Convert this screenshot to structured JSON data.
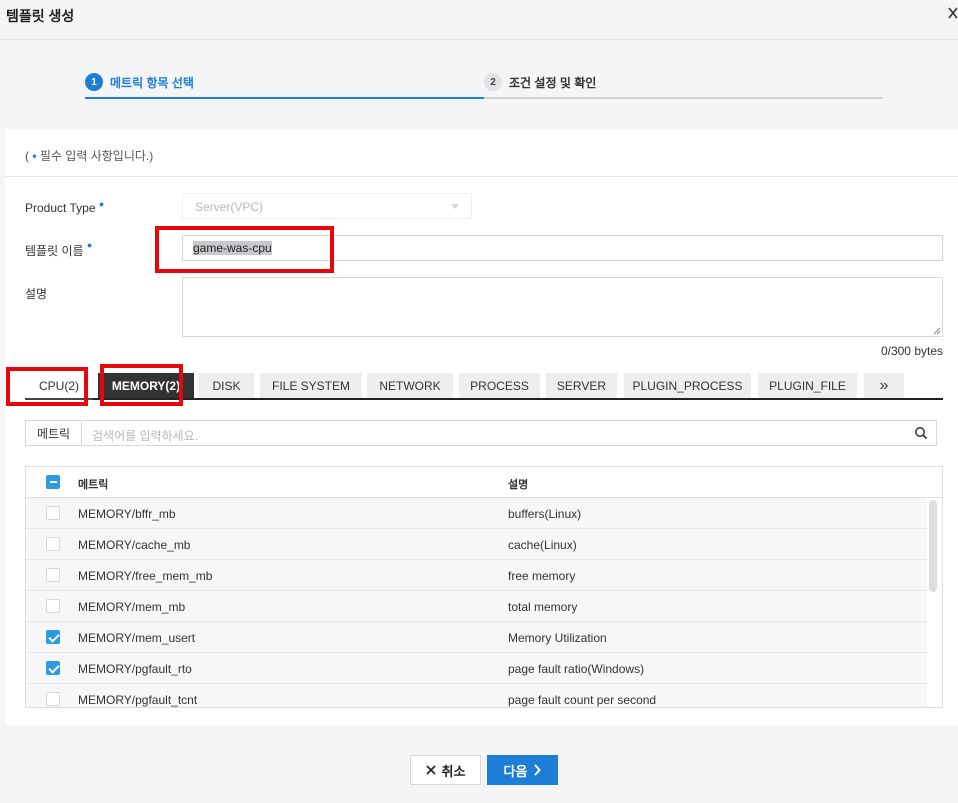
{
  "header": {
    "title": "템플릿 생성",
    "close_icon": "close-icon"
  },
  "steps": [
    {
      "num": "1",
      "label": "메트릭 항목 선택",
      "state": "active"
    },
    {
      "num": "2",
      "label": "조건 설정 및 확인",
      "state": "inactive"
    }
  ],
  "form": {
    "required_note_open": "( ",
    "required_note_dot": "•",
    "required_note_text": " 필수 입력 사항입니다.)",
    "required_dot": "●",
    "product_type_label": "Product Type",
    "product_type_value": "Server(VPC)",
    "template_name_label": "템플릿 이름",
    "template_name_value": "game-was-cpu",
    "description_label": "설명",
    "description_value": "",
    "byte_count": "0/300 bytes"
  },
  "tabs": [
    {
      "label": "CPU(2)",
      "state": "selected-plain"
    },
    {
      "label": "MEMORY(2)",
      "state": "active"
    },
    {
      "label": "DISK"
    },
    {
      "label": "FILE SYSTEM"
    },
    {
      "label": "NETWORK"
    },
    {
      "label": "PROCESS"
    },
    {
      "label": "SERVER"
    },
    {
      "label": "PLUGIN_PROCESS"
    },
    {
      "label": "PLUGIN_FILE"
    },
    {
      "label": "»"
    }
  ],
  "search": {
    "label": "메트릭",
    "placeholder": "검색어를 입력하세요."
  },
  "table": {
    "columns": [
      "메트릭",
      "설명"
    ],
    "header_checkbox": "partial",
    "rows": [
      {
        "metric": "MEMORY/bffr_mb",
        "description": "buffers(Linux)",
        "checked": false
      },
      {
        "metric": "MEMORY/cache_mb",
        "description": "cache(Linux)",
        "checked": false
      },
      {
        "metric": "MEMORY/free_mem_mb",
        "description": "free memory",
        "checked": false
      },
      {
        "metric": "MEMORY/mem_mb",
        "description": "total memory",
        "checked": false
      },
      {
        "metric": "MEMORY/mem_usert",
        "description": "Memory Utilization",
        "checked": true
      },
      {
        "metric": "MEMORY/pgfault_rto",
        "description": "page fault ratio(Windows)",
        "checked": true
      },
      {
        "metric": "MEMORY/pgfault_tcnt",
        "description": "page fault count per second",
        "checked": false
      }
    ]
  },
  "footer": {
    "cancel_label": "취소",
    "next_label": "다음"
  },
  "colors": {
    "accent": "#1d7ed8",
    "checkbox": "#2d9be0",
    "highlight_box": "#e8060b",
    "active_tab": "#333333"
  }
}
